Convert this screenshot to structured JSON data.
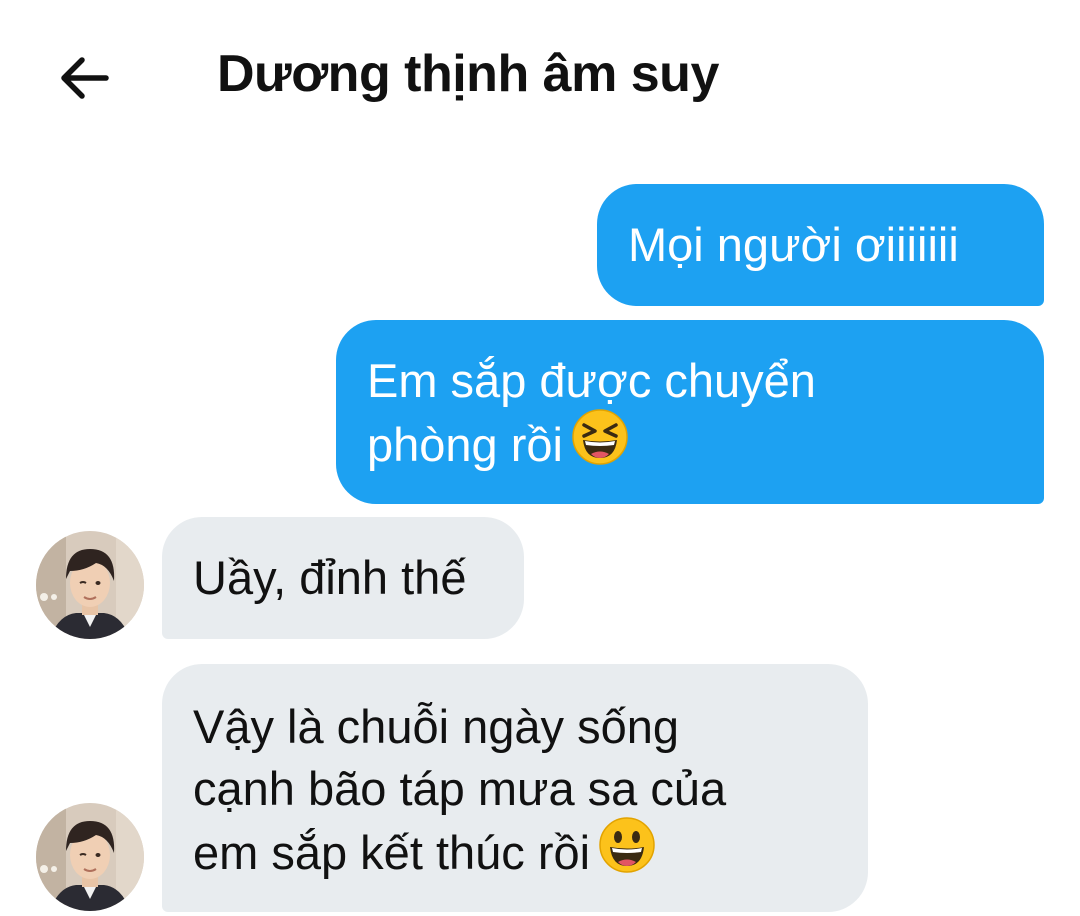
{
  "header": {
    "back_icon": "arrow-left-icon",
    "title": "Dương thịnh âm suy"
  },
  "messages": [
    {
      "direction": "outgoing",
      "lines": [
        "Mọi người ơiiiiiii"
      ]
    },
    {
      "direction": "outgoing",
      "lines": [
        "Em sắp được chuyển",
        "phòng rồi"
      ],
      "emoji": "grinning-squinting-face"
    },
    {
      "direction": "incoming",
      "lines": [
        "Uầy, đỉnh thế"
      ],
      "avatar": "contact-avatar"
    },
    {
      "direction": "incoming",
      "lines": [
        "Vậy là chuỗi ngày sống",
        "cạnh bão táp mưa sa của",
        "em sắp kết thúc rồi"
      ],
      "emoji": "grinning-face",
      "avatar": "contact-avatar"
    }
  ],
  "colors": {
    "outgoing_bubble": "#1da1f2",
    "incoming_bubble": "#e8ecef",
    "outgoing_text": "#ffffff",
    "incoming_text": "#111111"
  }
}
